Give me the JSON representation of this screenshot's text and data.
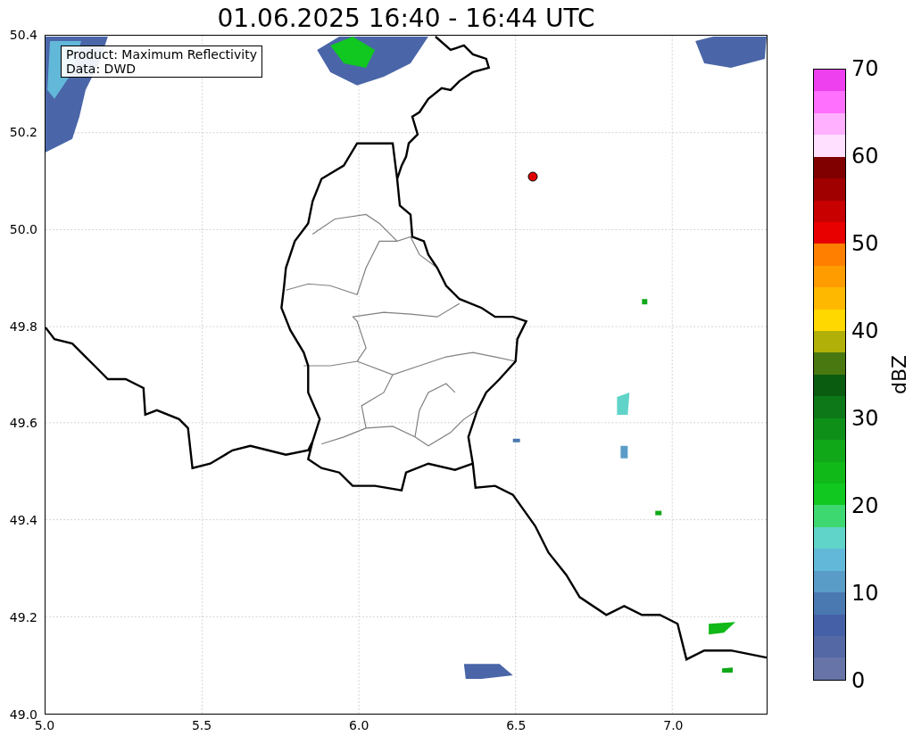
{
  "title": "01.06.2025 16:40 - 16:44 UTC",
  "map": {
    "legend": [
      "Product: Maximum Reflectivity",
      "Data: DWD"
    ],
    "y_ticks": [
      "50.4",
      "50.2",
      "50.0",
      "49.8",
      "49.6",
      "49.4",
      "49.2",
      "49.0"
    ],
    "x_ticks": [
      "5.0",
      "5.5",
      "6.0",
      "6.5",
      "7.0"
    ]
  },
  "colorbar": {
    "label": "dBZ",
    "ticks": [
      "70",
      "60",
      "50",
      "40",
      "30",
      "20",
      "10",
      "0"
    ],
    "segments": [
      {
        "color": "#ee40ee"
      },
      {
        "color": "#ff70ff"
      },
      {
        "color": "#ffb0ff"
      },
      {
        "color": "#ffe0ff"
      },
      {
        "color": "#800000"
      },
      {
        "color": "#a00000"
      },
      {
        "color": "#c80000"
      },
      {
        "color": "#e80000"
      },
      {
        "color": "#ff8000"
      },
      {
        "color": "#ff9c00"
      },
      {
        "color": "#ffb800"
      },
      {
        "color": "#ffd800"
      },
      {
        "color": "#b0b008"
      },
      {
        "color": "#4a7810"
      },
      {
        "color": "#0a5c10"
      },
      {
        "color": "#0c7818"
      },
      {
        "color": "#0e9018"
      },
      {
        "color": "#10a818"
      },
      {
        "color": "#10b818"
      },
      {
        "color": "#10c820"
      },
      {
        "color": "#3ed870"
      },
      {
        "color": "#60d4c8"
      },
      {
        "color": "#62b8d8"
      },
      {
        "color": "#5a9cc8"
      },
      {
        "color": "#4a78b0"
      },
      {
        "color": "#4560a6"
      },
      {
        "color": "#5468a6"
      },
      {
        "color": "#6674a8"
      }
    ]
  }
}
